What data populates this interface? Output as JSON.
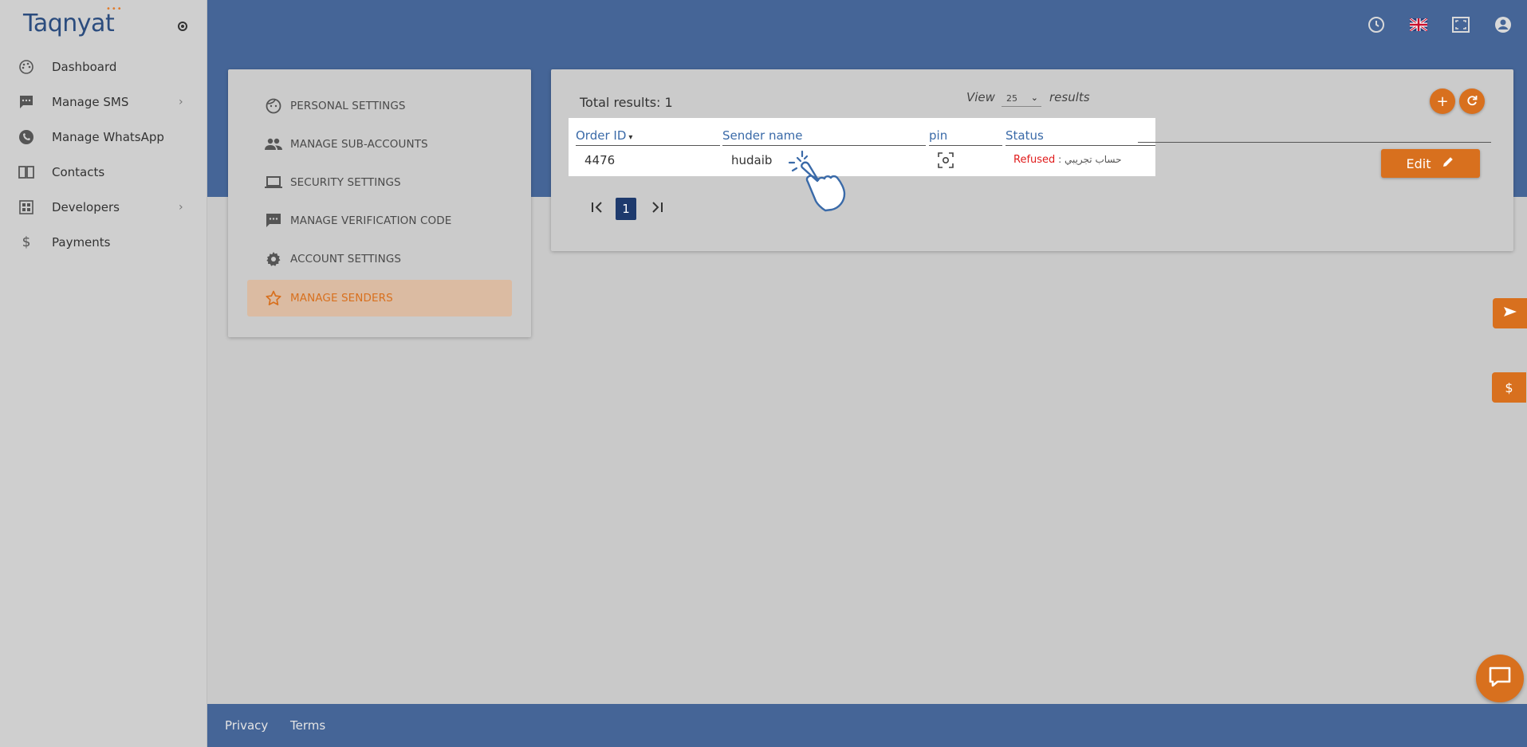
{
  "sidebar": {
    "logo": "Taqnyat",
    "items": [
      {
        "label": "Dashboard",
        "icon": "palette-icon"
      },
      {
        "label": "Manage SMS",
        "icon": "sms-icon",
        "has_submenu": true
      },
      {
        "label": "Manage WhatsApp",
        "icon": "whatsapp-icon"
      },
      {
        "label": "Contacts",
        "icon": "contacts-book-icon"
      },
      {
        "label": "Developers",
        "icon": "developers-icon",
        "has_submenu": true
      },
      {
        "label": "Payments",
        "icon": "dollar-icon"
      }
    ]
  },
  "header": {
    "icons": [
      "clock-icon",
      "uk-flag-icon",
      "fullscreen-icon",
      "account-icon"
    ]
  },
  "settings_menu": {
    "items": [
      {
        "label": "PERSONAL SETTINGS",
        "icon": "face-icon"
      },
      {
        "label": "MANAGE SUB-ACCOUNTS",
        "icon": "people-icon"
      },
      {
        "label": "SECURITY SETTINGS",
        "icon": "laptop-icon"
      },
      {
        "label": "MANAGE VERIFICATION CODE",
        "icon": "message-icon"
      },
      {
        "label": "ACCOUNT SETTINGS",
        "icon": "gear-icon"
      },
      {
        "label": "MANAGE SENDERS",
        "icon": "star-icon",
        "active": true
      }
    ]
  },
  "senders": {
    "total_label": "Total results: 1",
    "view_label": "View",
    "page_size": "25",
    "results_label": "results",
    "columns": [
      "Order ID",
      "Sender name",
      "pin",
      "Status"
    ],
    "rows": [
      {
        "order_id": "4476",
        "sender_name": "hudaib",
        "status": "Refused",
        "status_sep": " : ",
        "status_note": "حساب تجريبي"
      }
    ],
    "edit_label": "Edit",
    "current_page": "1"
  },
  "footer": {
    "privacy": "Privacy",
    "terms": "Terms"
  },
  "colors": {
    "brand_blue": "#456597",
    "accent_orange": "#d8701e",
    "refused_red": "#e01b1b"
  }
}
